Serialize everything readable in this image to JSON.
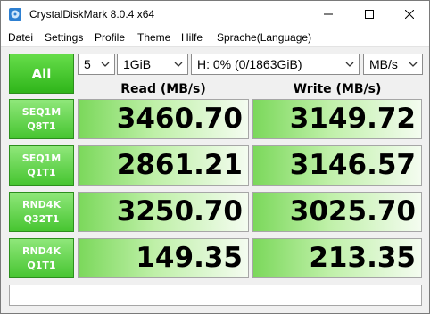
{
  "window": {
    "title": "CrystalDiskMark 8.0.4 x64"
  },
  "menu": [
    "Datei",
    "Settings",
    "Profile",
    "Theme",
    "Hilfe",
    "Sprache(Language)"
  ],
  "controls": {
    "all_label": "All",
    "count": "5",
    "size": "1GiB",
    "drive": "H: 0% (0/1863GiB)",
    "unit": "MB/s"
  },
  "headers": {
    "read": "Read (MB/s)",
    "write": "Write (MB/s)"
  },
  "rows": [
    {
      "line1": "SEQ1M",
      "line2": "Q8T1",
      "read": "3460.70",
      "write": "3149.72"
    },
    {
      "line1": "SEQ1M",
      "line2": "Q1T1",
      "read": "2861.21",
      "write": "3146.57"
    },
    {
      "line1": "RND4K",
      "line2": "Q32T1",
      "read": "3250.70",
      "write": "3025.70"
    },
    {
      "line1": "RND4K",
      "line2": "Q1T1",
      "read": "149.35",
      "write": "213.35"
    }
  ],
  "comment": "",
  "colors": {
    "accent_green": "#47c531"
  }
}
